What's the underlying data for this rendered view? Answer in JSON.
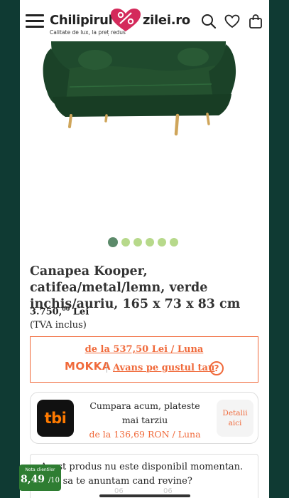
{
  "header": {
    "logo_left": "Chilipirul",
    "logo_right": "zilei.ro",
    "logo_tagline": "Calitate de lux, la preț redus",
    "icons": [
      "menu-icon",
      "search-icon",
      "heart-icon",
      "bag-icon"
    ],
    "accent": "#d42a5b"
  },
  "gallery": {
    "product_color": "#1f4a2d",
    "leg_color": "#cfa55a",
    "dot_count": 6,
    "active_dot": 0
  },
  "product": {
    "title": "Canapea Kooper, catifea/metal/lemn, verde inchis/auriu, 165 x 73 x 83 cm",
    "price_main": "3.750,",
    "price_decimals": "00",
    "price_currency": " Lei",
    "tva": "(TVA inclus)"
  },
  "mokka": {
    "installment": "de la 537,50 Lei / Luna",
    "logo": "MOKKA",
    "link": "Avans pe gustul tau",
    "help": "?",
    "color": "#f06a3b"
  },
  "tbi": {
    "logo": "tbi",
    "line1": "Cumpara acum, plateste mai tarziu",
    "rate": "de la 136,69 RON / Luna",
    "details": "Detalii aici"
  },
  "stock": {
    "text": "Acest produs nu este disponibil momentan. Vrei sa te anuntam cand revine?"
  },
  "rating": {
    "label": "Nota clientilor",
    "value": "8,49",
    "max": "/10"
  },
  "faint": {
    "left": "06",
    "right": "06"
  }
}
